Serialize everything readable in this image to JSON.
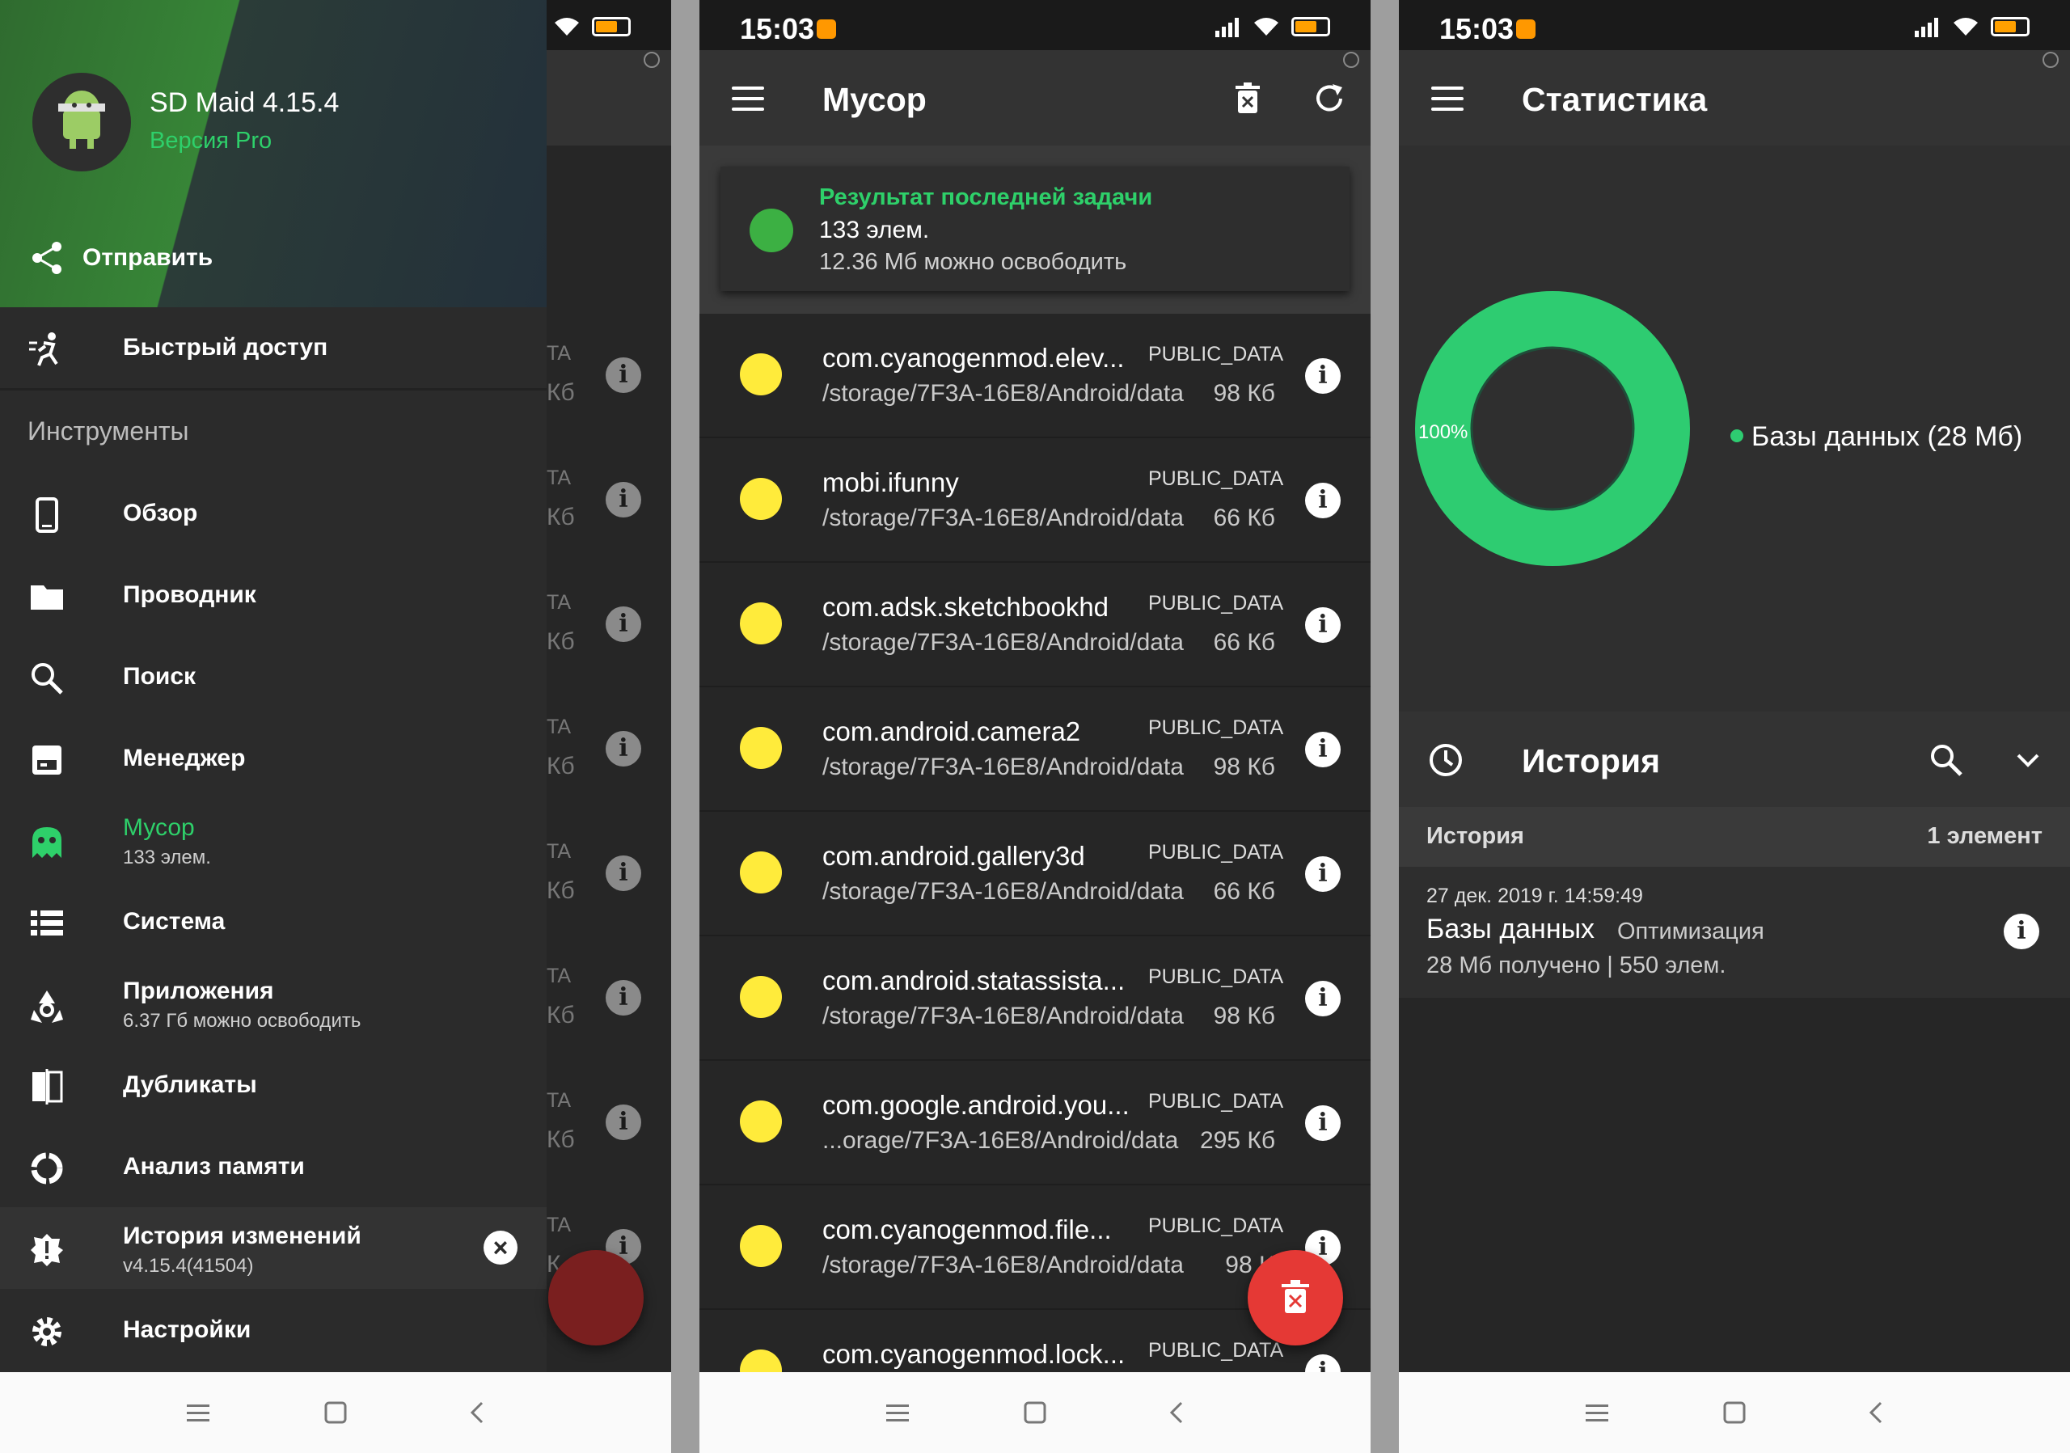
{
  "status": {
    "time": "15:03",
    "battery": "67"
  },
  "screen1": {
    "drawer": {
      "app_name": "SD Maid 4.15.4",
      "version_label": "Версия Pro",
      "share_label": "Отправить",
      "quick_access": "Быстрый доступ",
      "section_tools": "Инструменты",
      "items": [
        {
          "label": "Обзор"
        },
        {
          "label": "Проводник"
        },
        {
          "label": "Поиск"
        },
        {
          "label": "Менеджер"
        },
        {
          "label": "Мусор",
          "sub": "133 элем."
        },
        {
          "label": "Система"
        },
        {
          "label": "Приложения",
          "sub": "6.37 Гб можно освободить"
        },
        {
          "label": "Дубликаты"
        },
        {
          "label": "Анализ памяти"
        },
        {
          "label": "История изменений",
          "sub": "v4.15.4(41504)"
        },
        {
          "label": "Настройки"
        }
      ]
    },
    "behind": {
      "tag_fragment": "TA",
      "size_fragment": "Кб",
      "size_fragment_short": "К"
    }
  },
  "screen2": {
    "title": "Мусор",
    "card": {
      "title": "Результат последней задачи",
      "count": "133 элем.",
      "freeable": "12.36 Мб можно освободить"
    },
    "rows": [
      {
        "name": "com.cyanogenmod.elev...",
        "tag": "PUBLIC_DATA",
        "path": "/storage/7F3A-16E8/Android/data",
        "size": "98 Кб"
      },
      {
        "name": "mobi.ifunny",
        "tag": "PUBLIC_DATA",
        "path": "/storage/7F3A-16E8/Android/data",
        "size": "66 Кб"
      },
      {
        "name": "com.adsk.sketchbookhd",
        "tag": "PUBLIC_DATA",
        "path": "/storage/7F3A-16E8/Android/data",
        "size": "66 Кб"
      },
      {
        "name": "com.android.camera2",
        "tag": "PUBLIC_DATA",
        "path": "/storage/7F3A-16E8/Android/data",
        "size": "98 Кб"
      },
      {
        "name": "com.android.gallery3d",
        "tag": "PUBLIC_DATA",
        "path": "/storage/7F3A-16E8/Android/data",
        "size": "66 Кб"
      },
      {
        "name": "com.android.statassista...",
        "tag": "PUBLIC_DATA",
        "path": "/storage/7F3A-16E8/Android/data",
        "size": "98 Кб"
      },
      {
        "name": "com.google.android.you...",
        "tag": "PUBLIC_DATA",
        "path": "...orage/7F3A-16E8/Android/data",
        "size": "295 Кб"
      },
      {
        "name": "com.cyanogenmod.file...",
        "tag": "PUBLIC_DATA",
        "path": "/storage/7F3A-16E8/Android/data",
        "size": "98 K"
      },
      {
        "name": "com.cyanogenmod.lock...",
        "tag": "PUBLIC_DATA",
        "path": "",
        "size": ""
      }
    ]
  },
  "screen3": {
    "title": "Статистика",
    "chart_data": {
      "type": "pie",
      "categories": [
        "Базы данных (28 Мб)"
      ],
      "values": [
        100
      ],
      "slice_label": "100%",
      "legend_position": "right",
      "colors": [
        "#2ecc71"
      ]
    },
    "history": {
      "title": "История",
      "sub_label": "История",
      "sub_count": "1 элемент",
      "entry": {
        "date": "27 дек. 2019 г. 14:59:49",
        "name": "Базы данных",
        "action": "Оптимизация",
        "details": "28 Мб получено | 550 элем."
      }
    }
  },
  "colors": {
    "accent_green": "#2ed06a",
    "item_yellow": "#ffeb3b",
    "fab_red": "#e53935"
  }
}
